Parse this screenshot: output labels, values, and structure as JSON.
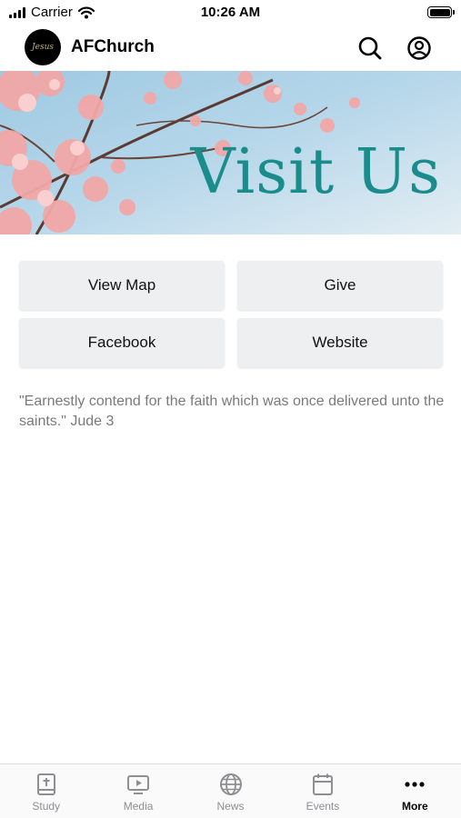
{
  "status_bar": {
    "carrier": "Carrier",
    "time": "10:26 AM"
  },
  "header": {
    "title": "AFChurch",
    "logo_text": "Jesus"
  },
  "banner": {
    "text": "Visit Us",
    "accent_color": "#1a8c8c"
  },
  "buttons": {
    "view_map": "View Map",
    "give": "Give",
    "facebook": "Facebook",
    "website": "Website"
  },
  "verse": "\"Earnestly contend for the faith which was once delivered unto the saints.\" Jude 3",
  "tabs": [
    {
      "label": "Study",
      "icon": "bible-icon"
    },
    {
      "label": "Media",
      "icon": "media-icon"
    },
    {
      "label": "News",
      "icon": "globe-icon"
    },
    {
      "label": "Events",
      "icon": "calendar-icon"
    },
    {
      "label": "More",
      "icon": "more-icon"
    }
  ],
  "active_tab": "More"
}
